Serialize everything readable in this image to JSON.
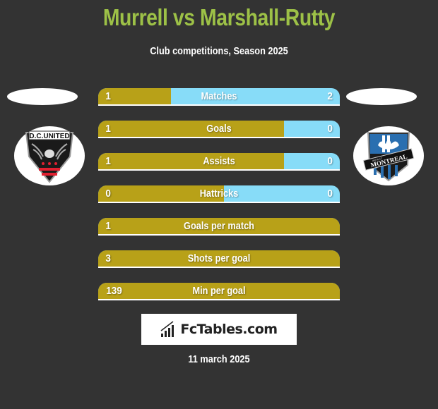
{
  "header": {
    "title": "Murrell vs Marshall-Rutty",
    "subtitle": "Club competitions, Season 2025"
  },
  "teams": {
    "left": {
      "name": "D.C. United",
      "badge_text": "D.C.UNITED",
      "icon": "dc-united-crest-icon"
    },
    "right": {
      "name": "Impact Montreal",
      "badge_text_small": "IMPACT",
      "badge_text": "MONTREAL",
      "icon": "impact-montreal-crest-icon"
    }
  },
  "colors": {
    "title": "#9dc147",
    "left_bar": "#b8a118",
    "right_bar": "#87dcf8",
    "background": "#333333"
  },
  "stats": [
    {
      "label": "Matches",
      "left": "1",
      "right": "2",
      "left_share": 0.3
    },
    {
      "label": "Goals",
      "left": "1",
      "right": "0",
      "left_share": 0.77
    },
    {
      "label": "Assists",
      "left": "1",
      "right": "0",
      "left_share": 0.77
    },
    {
      "label": "Hattricks",
      "left": "0",
      "right": "0",
      "left_share": 0.52
    },
    {
      "label": "Goals per match",
      "left": "1",
      "right": "",
      "left_share": 1.0
    },
    {
      "label": "Shots per goal",
      "left": "3",
      "right": "",
      "left_share": 1.0
    },
    {
      "label": "Min per goal",
      "left": "139",
      "right": "",
      "left_share": 1.0
    }
  ],
  "footer": {
    "brand": "FcTables.com",
    "brand_icon": "bar-chart-icon",
    "date": "11 march 2025"
  }
}
